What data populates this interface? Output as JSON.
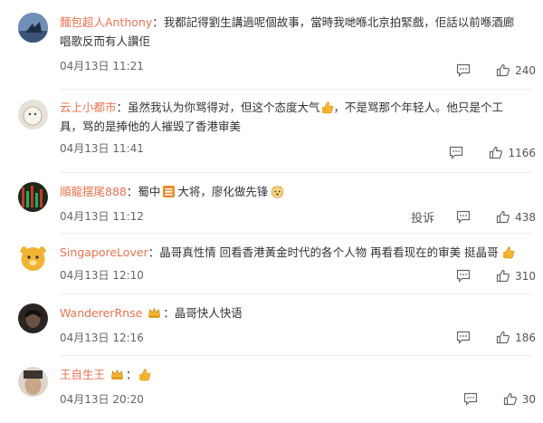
{
  "comments": [
    {
      "user": "麵包超人Anthony",
      "colon": "：",
      "text": "我都記得劉生講過呢個故事，當時我哋喺北京拍緊戲，佢話以前喺酒廊唱歌反而有人讚佢",
      "time": "04月13日 11:21",
      "likes": "240",
      "avatar_color": "#4a6fa0"
    },
    {
      "user": "云上小都市",
      "colon": "：",
      "text_a": "虽然我认为你骂得对，但这个态度大气",
      "text_b": "，不是骂那个年轻人。他只是个工具，骂的是捧他的人摧毁了香港审美",
      "time": "04月13日 11:41",
      "likes": "1166",
      "avatar_color": "#d8d3c8"
    },
    {
      "user": "順龍摆尾888",
      "colon": "：",
      "text_a": "蜀中",
      "text_b": "大将，廖化做先锋",
      "time": "04月13日 11:12",
      "report_label": "投诉",
      "likes": "438",
      "avatar_color": "#2f3f2a"
    },
    {
      "user": "SingaporeLover",
      "colon": "：",
      "text": "晶哥真性情 回看香港黃金时代的各个人物 再看看现在的审美 挺晶哥",
      "time": "04月13日 12:10",
      "likes": "310",
      "avatar_color": "#f2b233"
    },
    {
      "user": "WandererRnse",
      "colon": "：",
      "text": "晶哥快人快语",
      "time": "04月13日 12:16",
      "likes": "186",
      "avatar_color": "#3a3330"
    },
    {
      "user": "王自生王",
      "colon": "：",
      "time": "04月13日 20:20",
      "likes": "30",
      "avatar_color": "#c9c2b8"
    }
  ],
  "colors": {
    "username": "#eb7350",
    "text": "#333333",
    "meta": "#666666",
    "accent_yellow": "#f5b531"
  },
  "icons": [
    "reply-icon",
    "like-icon",
    "thumbs-up-emoji",
    "crown-badge-icon"
  ]
}
